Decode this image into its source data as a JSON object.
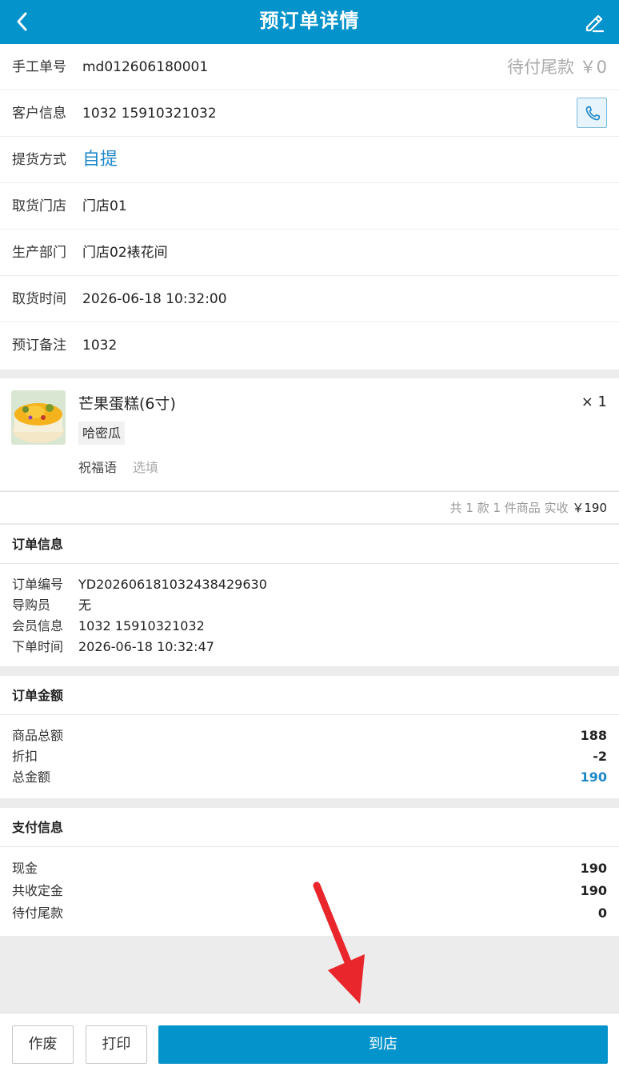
{
  "header": {
    "title": "预订单详情",
    "back_icon": "back-chevron-icon",
    "edit_icon": "pencil-edit-icon"
  },
  "info": {
    "manual_no": {
      "label": "手工单号",
      "value": "md012606180001"
    },
    "pending": "待付尾款 ￥0",
    "customer": {
      "label": "客户信息",
      "value": "1032 15910321032"
    },
    "pickup_method": {
      "label": "提货方式",
      "value": "自提"
    },
    "pickup_store": {
      "label": "取货门店",
      "value": "门店01"
    },
    "production": {
      "label": "生产部门",
      "value": "门店02裱花间"
    },
    "pickup_time": {
      "label": "取货时间",
      "value": "2026-06-18 10:32:00"
    },
    "note": {
      "label": "预订备注",
      "value": "1032"
    }
  },
  "product": {
    "name": "芒果蛋糕(6寸)",
    "qty": "× 1",
    "tag": "哈密瓜",
    "blessing_label": "祝福语",
    "blessing_placeholder": "选填"
  },
  "summary": {
    "text": "共 1 款 1 件商品 实收",
    "amount": "￥190"
  },
  "order_info": {
    "title": "订单信息",
    "rows": [
      {
        "k": "订单编号",
        "v": "YD2026061810324384296​30"
      },
      {
        "k": "导购员",
        "v": "无"
      },
      {
        "k": "会员信息",
        "v": "1032 15910321032"
      },
      {
        "k": "下单时间",
        "v": "2026-06-18 10:32:47"
      }
    ]
  },
  "order_amount": {
    "title": "订单金额",
    "rows": [
      {
        "k": "商品总额",
        "v": "188"
      },
      {
        "k": "折扣",
        "v": "-2"
      },
      {
        "k": "总金额",
        "v": "190"
      }
    ]
  },
  "payment": {
    "title": "支付信息",
    "rows": [
      {
        "k": "现金",
        "v": "190"
      },
      {
        "k": "共收定金",
        "v": "190"
      },
      {
        "k": "待付尾款",
        "v": "0"
      }
    ]
  },
  "buttons": {
    "void": "作废",
    "print": "打印",
    "arrive": "到店"
  },
  "colors": {
    "primary": "#0593cb",
    "link": "#1e88c7",
    "annotation_arrow": "#e8262b"
  }
}
